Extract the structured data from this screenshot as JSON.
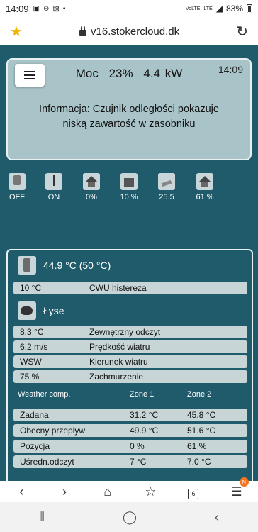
{
  "status_bar": {
    "time": "14:09",
    "lte_label_1": "VoLTE",
    "lte_label_2": "LTE",
    "battery": "83%"
  },
  "browser": {
    "url": "v16.stokercloud.dk",
    "tabs_count": "6",
    "notification_badge": "N"
  },
  "top_card": {
    "power_label": "Moc",
    "power_percent": "23%",
    "power_kw": "4.4 kW",
    "clock": "14:09",
    "info": "Informacja: Czujnik odległości pokazuje niską zawartość w zasobniku"
  },
  "status_icons": [
    {
      "icon": "boiler-icon",
      "value": "OFF"
    },
    {
      "icon": "thermometer-icon",
      "value": "ON"
    },
    {
      "icon": "house-icon",
      "value": "0%"
    },
    {
      "icon": "hopper-icon",
      "value": "10 %"
    },
    {
      "icon": "outdoor-icon",
      "value": "25.5"
    },
    {
      "icon": "house-icon",
      "value": "61 %"
    }
  ],
  "hot_water": {
    "temperature": "44.9 °C (50 °C)",
    "hysteresis_value": "10 °C",
    "hysteresis_label": "CWU histereza"
  },
  "weather": {
    "location": "Łyse",
    "rows": [
      {
        "value": "8.3 °C",
        "label": "Zewnętrzny odczyt"
      },
      {
        "value": "6.2 m/s",
        "label": "Prędkość wiatru"
      },
      {
        "value": "WSW",
        "label": "Kierunek wiatru"
      },
      {
        "value": "75 %",
        "label": "Zachmurzenie"
      }
    ]
  },
  "weather_comp": {
    "header": {
      "title": "Weather comp.",
      "zone1": "Zone 1",
      "zone2": "Zone 2"
    },
    "rows": [
      {
        "label": "Zadana",
        "zone1": "31.2 °C",
        "zone2": "45.8 °C"
      },
      {
        "label": "Obecny przepływ",
        "zone1": "49.9 °C",
        "zone2": "51.6 °C"
      },
      {
        "label": "Pozycja",
        "zone1": "0 %",
        "zone2": "61 %"
      },
      {
        "label": "Uśredn.odczyt",
        "zone1": "7 °C",
        "zone2": "7.0 °C"
      }
    ]
  },
  "colors": {
    "page_background": "#1f5b6b",
    "card_background": "#a9c4c8",
    "row_background": "#c7d5d7",
    "star": "#f2b400",
    "badge": "#f37521"
  }
}
